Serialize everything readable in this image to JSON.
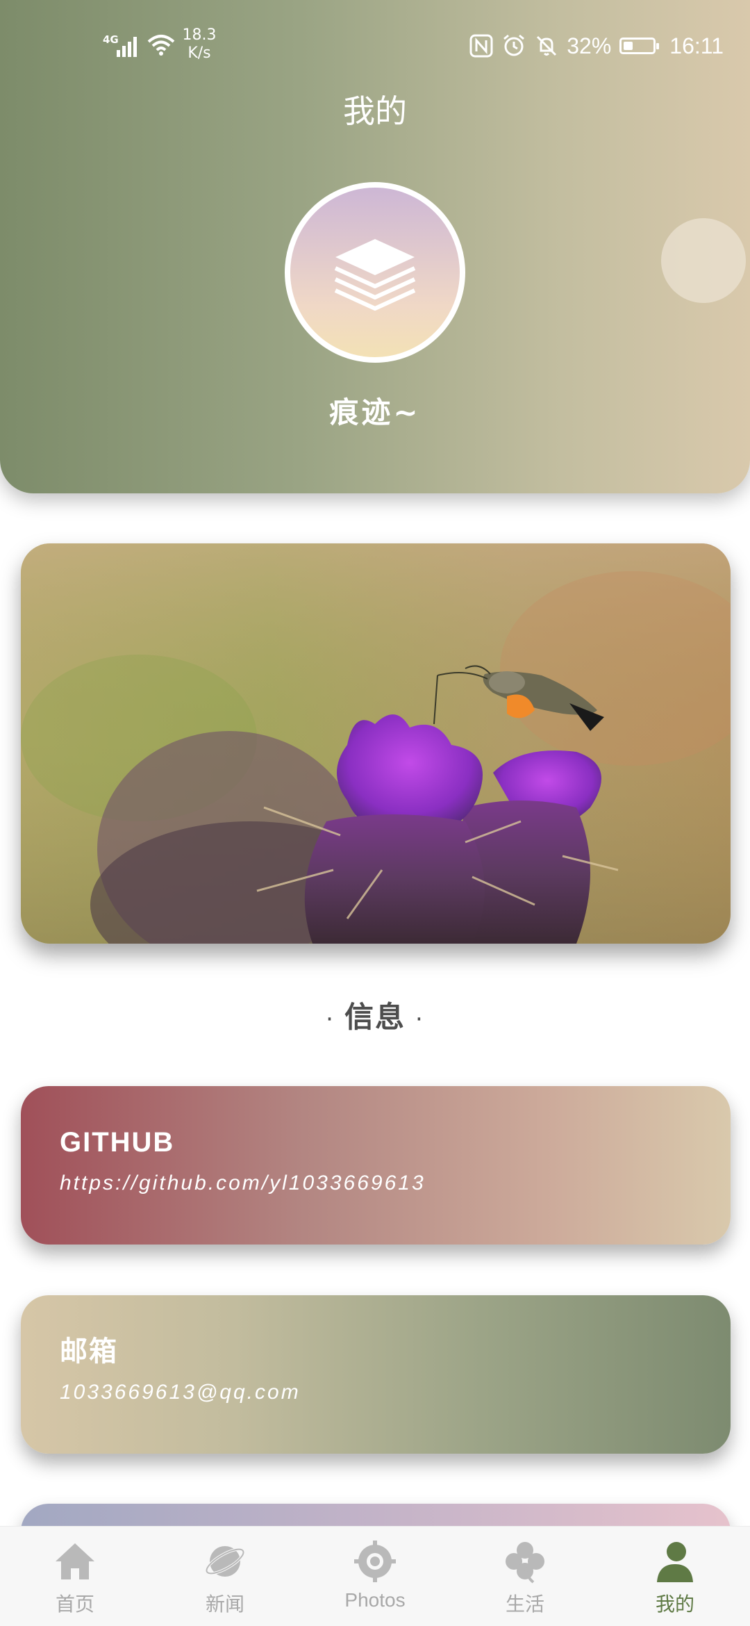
{
  "status_bar": {
    "network": "4G",
    "speed_value": "18.3",
    "speed_unit": "K/s",
    "battery_percent": "32%",
    "time": "16:11"
  },
  "header": {
    "title": "我的",
    "user_name": "痕迹~"
  },
  "info_section": {
    "title": "信息",
    "dot": "·"
  },
  "cards": [
    {
      "label": "GITHUB",
      "value": "https://github.com/yl1033669613"
    },
    {
      "label": "邮箱",
      "value": "1033669613@qq.com"
    }
  ],
  "nav": {
    "items": [
      {
        "label": "首页",
        "icon": "home-icon"
      },
      {
        "label": "新闻",
        "icon": "planet-icon"
      },
      {
        "label": "Photos",
        "icon": "aperture-icon"
      },
      {
        "label": "生活",
        "icon": "clover-icon"
      },
      {
        "label": "我的",
        "icon": "person-icon"
      }
    ],
    "active_index": 4
  },
  "colors": {
    "active": "#5f7a45",
    "inactive": "#a8a8a8"
  }
}
